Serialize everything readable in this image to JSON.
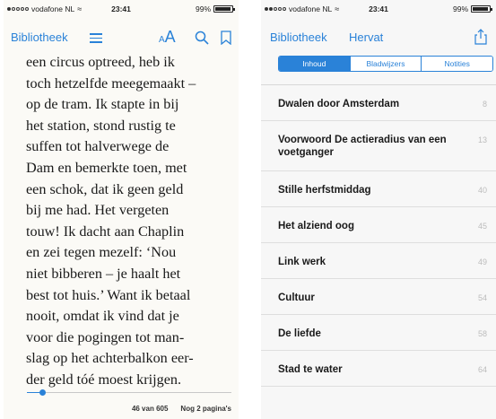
{
  "left": {
    "status": {
      "carrier": "vodafone NL",
      "time": "23:41",
      "battery": "99%"
    },
    "nav": {
      "library": "Bibliotheek",
      "font_small": "A",
      "font_big": "A"
    },
    "text_lines": [
      "een circus optreed, heb ik",
      "toch hetzelfde meegemaakt –",
      "op de tram. Ik stapte in bij",
      "het station, stond rustig te",
      "suffen tot halverwege de",
      "Dam en bemerkte toen, met",
      "een schok, dat ik geen geld",
      "bij me had. Het vergeten",
      "touw! Ik dacht aan Chaplin",
      "en zei tegen mezelf: ‘Nou",
      "niet bibberen – je haalt het",
      "best tot huis.’ Want ik betaal",
      "nooit, omdat ik vind dat je",
      "voor die pogingen tot man-",
      "slag op het achterbalkon eer-",
      "der geld tóé moest krijgen."
    ],
    "progress_fraction": 0.076,
    "footer": {
      "page_position": "46 van 605",
      "pages_left": "Nog 2 pagina's"
    }
  },
  "right": {
    "status": {
      "carrier": "vodafone NL",
      "time": "23:41",
      "battery": "99%"
    },
    "nav": {
      "library": "Bibliotheek",
      "resume": "Hervat"
    },
    "tabs": [
      {
        "label": "Inhoud",
        "active": true
      },
      {
        "label": "Bladwijzers",
        "active": false
      },
      {
        "label": "Notities",
        "active": false
      }
    ],
    "toc": [
      {
        "title": "Dwalen door Amsterdam",
        "page": "8"
      },
      {
        "title": "Voorwoord De actieradius van een voetganger",
        "page": "13"
      },
      {
        "title": "Stille herfstmiddag",
        "page": "40"
      },
      {
        "title": "Het alziend oog",
        "page": "45"
      },
      {
        "title": "Link werk",
        "page": "49"
      },
      {
        "title": "Cultuur",
        "page": "54"
      },
      {
        "title": "De liefde",
        "page": "58"
      },
      {
        "title": "Stad te water",
        "page": "64"
      }
    ]
  },
  "colors": {
    "accent": "#2a82d8",
    "page_number": "#bcbcbc"
  }
}
